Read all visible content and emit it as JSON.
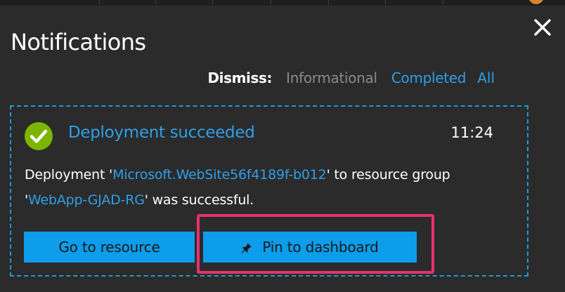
{
  "panel": {
    "title": "Notifications",
    "close_icon": "close-icon"
  },
  "dismiss": {
    "label": "Dismiss:",
    "options": [
      {
        "label": "Informational",
        "state": "disabled",
        "color": "#8a8a8a"
      },
      {
        "label": "Completed",
        "state": "enabled",
        "color": "#2f9fe6"
      },
      {
        "label": "All",
        "state": "enabled",
        "color": "#2f9fe6"
      }
    ]
  },
  "notification": {
    "status_icon": "success-check-icon",
    "status_color": "#7cb500",
    "title": "Deployment succeeded",
    "time": "11:24",
    "message": {
      "part1": "Deployment '",
      "deployment_name": "Microsoft.WebSite56f4189f-b012",
      "part2": "' to resource group '",
      "resource_group": "WebApp-GJAD-RG",
      "part3": "' was successful."
    },
    "actions": {
      "go_to_resource": "Go to resource",
      "pin_to_dashboard": "Pin to dashboard",
      "pin_icon": "pin-icon"
    }
  },
  "colors": {
    "background": "#2b2b2b",
    "accent": "#2f9fe6",
    "button": "#0d9dea",
    "highlight": "#e8316a"
  }
}
